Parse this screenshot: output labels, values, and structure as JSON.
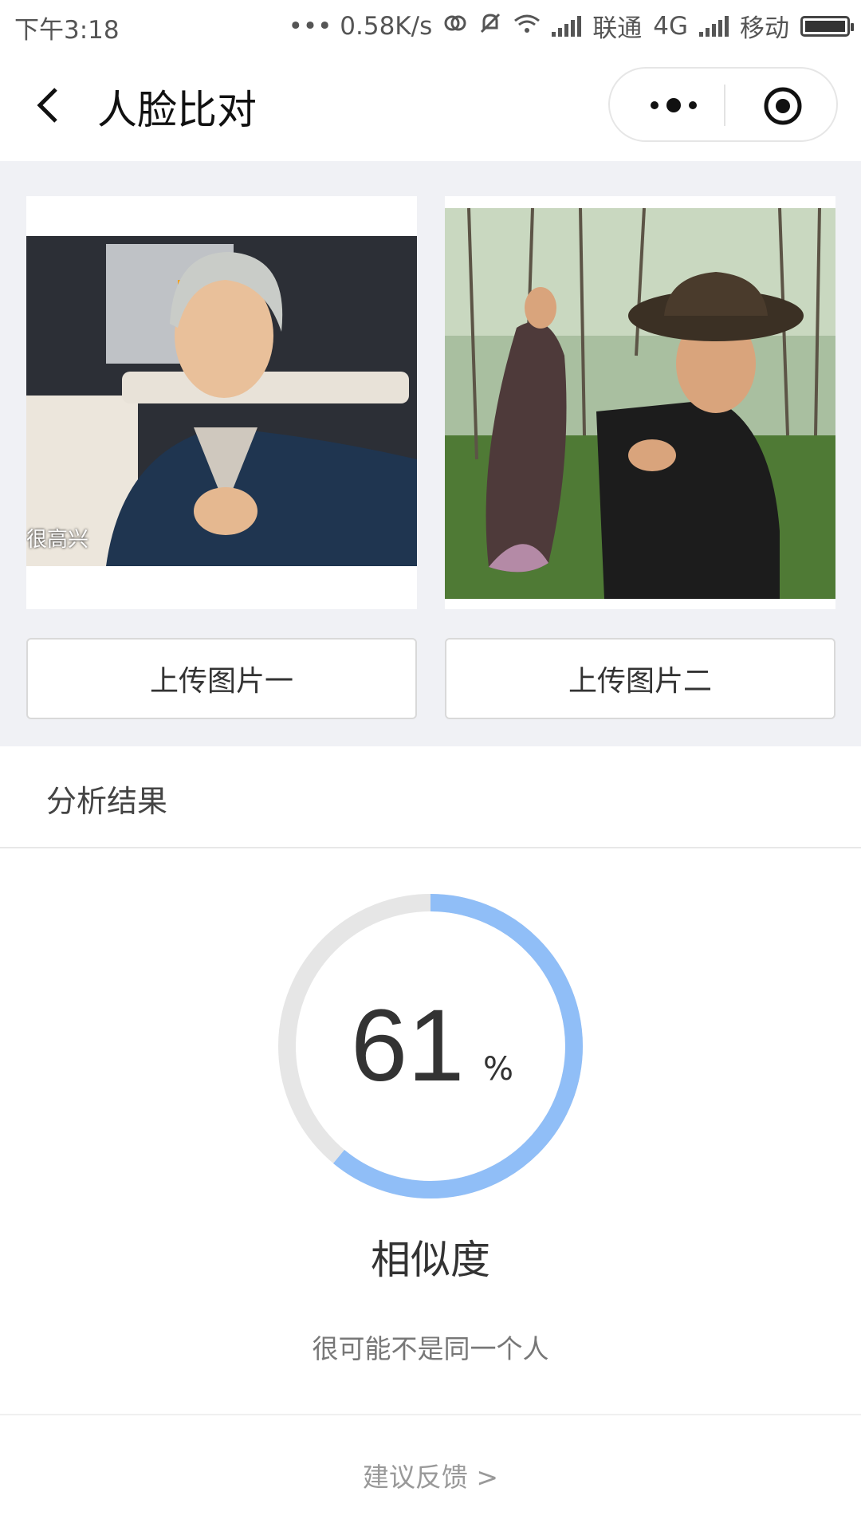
{
  "status_bar": {
    "time": "下午3:18",
    "network_speed": "••• 0.58K/s",
    "carrier1": "联通",
    "network_type": "4G",
    "carrier2": "移动"
  },
  "nav": {
    "title": "人脸比对"
  },
  "photos": {
    "photo1_caption": "很高兴",
    "upload1_label": "上传图片一",
    "upload2_label": "上传图片二"
  },
  "result": {
    "section_title": "分析结果",
    "similarity_value": "61",
    "similarity_fraction": 0.61,
    "percent_sign": "%",
    "similarity_label": "相似度",
    "verdict": "很可能不是同一个人",
    "feedback_link": "建议反馈 >"
  },
  "colors": {
    "gauge_fill": "#90bef7",
    "gauge_track": "#e6e6e6",
    "page_bg_gray": "#f0f1f5"
  }
}
